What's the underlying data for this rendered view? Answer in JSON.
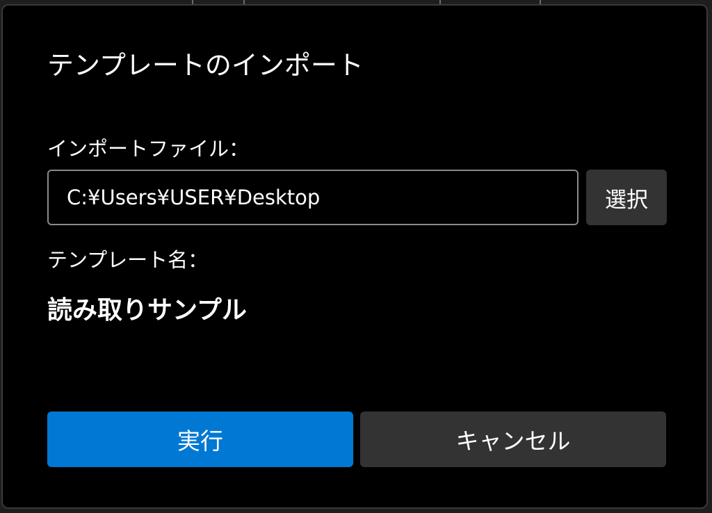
{
  "dialog": {
    "title": "テンプレートのインポート",
    "import_file_label": "インポートファイル：",
    "import_file_value": "C:¥Users¥USER¥Desktop",
    "select_button": "選択",
    "template_name_label": "テンプレート名：",
    "template_name_value": "読み取りサンプル",
    "execute_button": "実行",
    "cancel_button": "キャンセル"
  },
  "colors": {
    "dialog_background": "#000000",
    "primary_button": "#0078d4",
    "secondary_button": "#333333",
    "text": "#ffffff"
  }
}
